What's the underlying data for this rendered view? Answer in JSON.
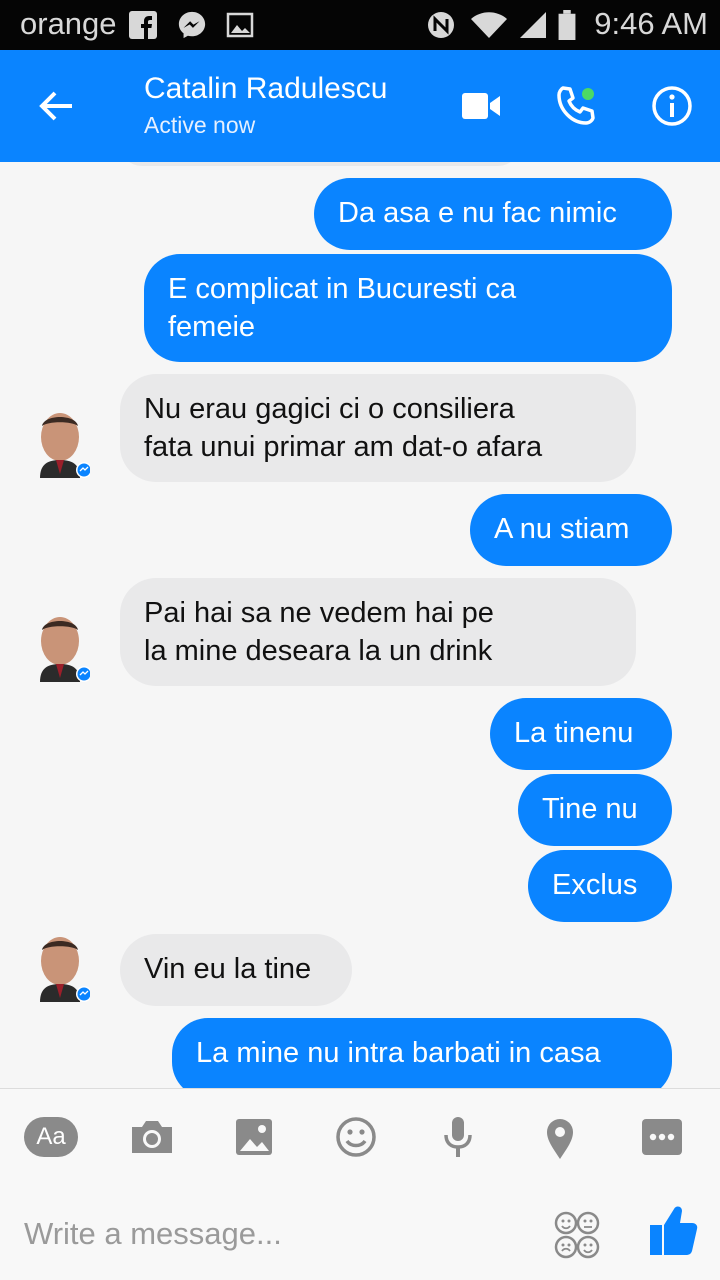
{
  "status_bar": {
    "carrier": "orange",
    "time": "9:46 AM",
    "icons": [
      "facebook-icon",
      "messenger-icon",
      "gallery-icon",
      "nfc-icon",
      "wifi-icon",
      "signal-icon",
      "battery-icon"
    ]
  },
  "header": {
    "contact_name": "Catalin Radulescu",
    "status": "Active now",
    "accent_color": "#0a84ff",
    "online_dot_color": "#4cd964"
  },
  "messages": [
    {
      "dir": "out",
      "text": "Da asa e nu fac nimic"
    },
    {
      "dir": "out",
      "text": "E complicat in Bucuresti ca\nfemeie"
    },
    {
      "dir": "in",
      "text": "Nu erau gagici ci o consiliera\nfata unui primar am dat-o afara"
    },
    {
      "dir": "out",
      "text": "A nu stiam"
    },
    {
      "dir": "in",
      "text": "Pai hai sa ne vedem hai pe\nla mine deseara la un drink"
    },
    {
      "dir": "out",
      "text": "La tinenu"
    },
    {
      "dir": "out",
      "text": "Tine nu"
    },
    {
      "dir": "out",
      "text": "Exclus"
    },
    {
      "dir": "in",
      "text": "Vin eu la tine"
    },
    {
      "dir": "out",
      "text": "La mine nu intra barbati in casa"
    }
  ],
  "composer": {
    "aa_label": "Aa",
    "placeholder": "Write a message...",
    "tools": [
      "camera-icon",
      "image-icon",
      "emoji-icon",
      "microphone-icon",
      "location-icon",
      "more-icon"
    ]
  }
}
